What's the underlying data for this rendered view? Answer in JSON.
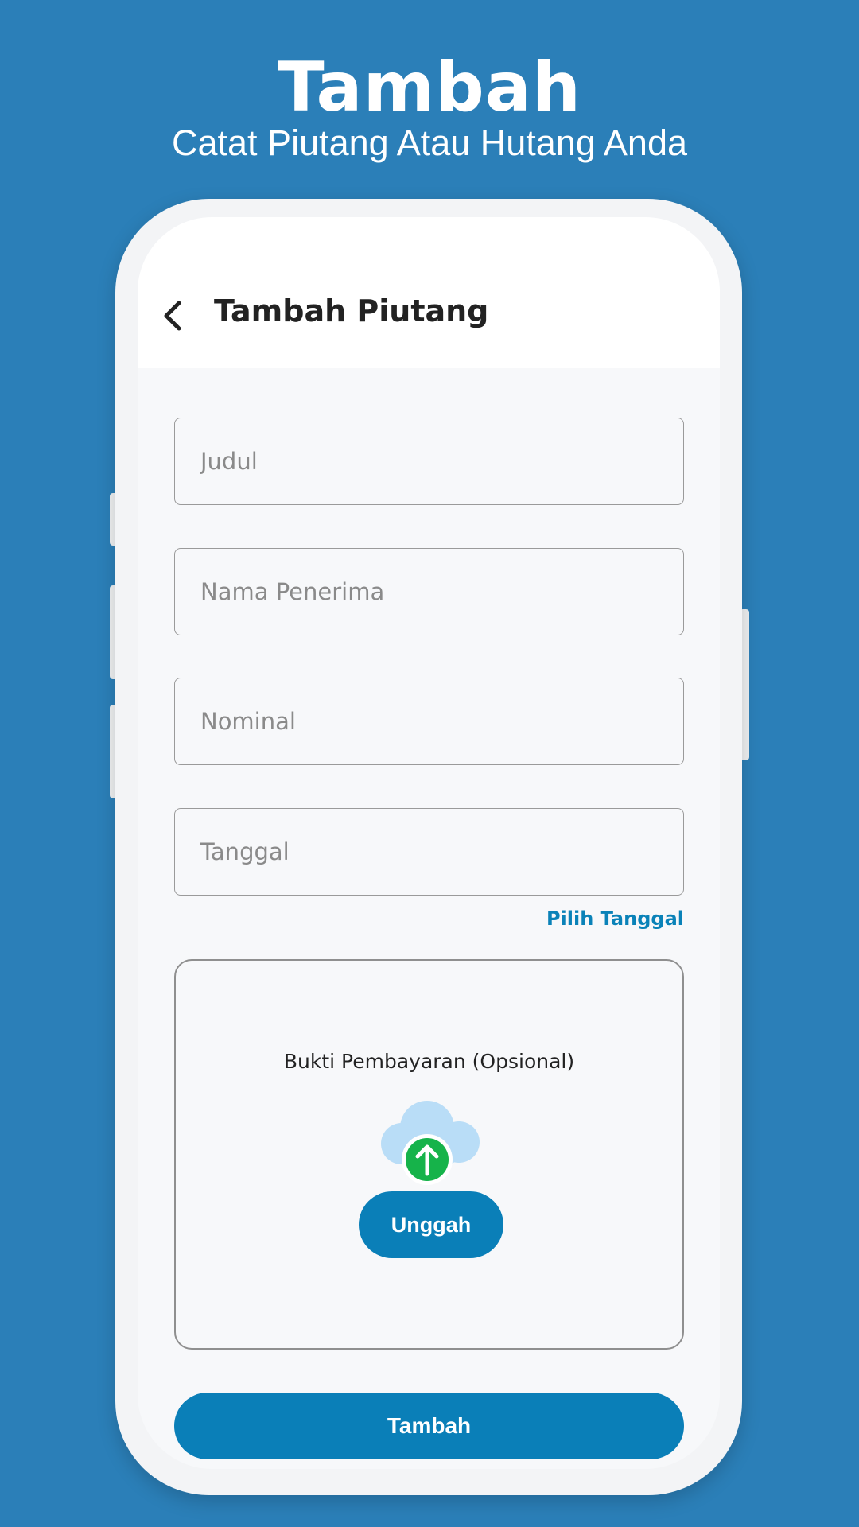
{
  "hero": {
    "title": "Tambah",
    "subtitle": "Catat Piutang Atau Hutang Anda"
  },
  "appbar": {
    "back_icon": "chevron-left-icon",
    "title": "Tambah Piutang"
  },
  "form": {
    "title_placeholder": "Judul",
    "recipient_placeholder": "Nama Penerima",
    "amount_placeholder": "Nominal",
    "date_placeholder": "Tanggal",
    "pick_date_label": "Pilih Tanggal"
  },
  "upload": {
    "label": "Bukti Pembayaran (Opsional)",
    "icon": "cloud-upload-icon",
    "button_label": "Unggah"
  },
  "submit": {
    "label": "Tambah"
  },
  "colors": {
    "background": "#2b7fb8",
    "accent": "#0a7fb8",
    "upload_arrow": "#16b34a",
    "cloud": "#b9ddf7"
  }
}
